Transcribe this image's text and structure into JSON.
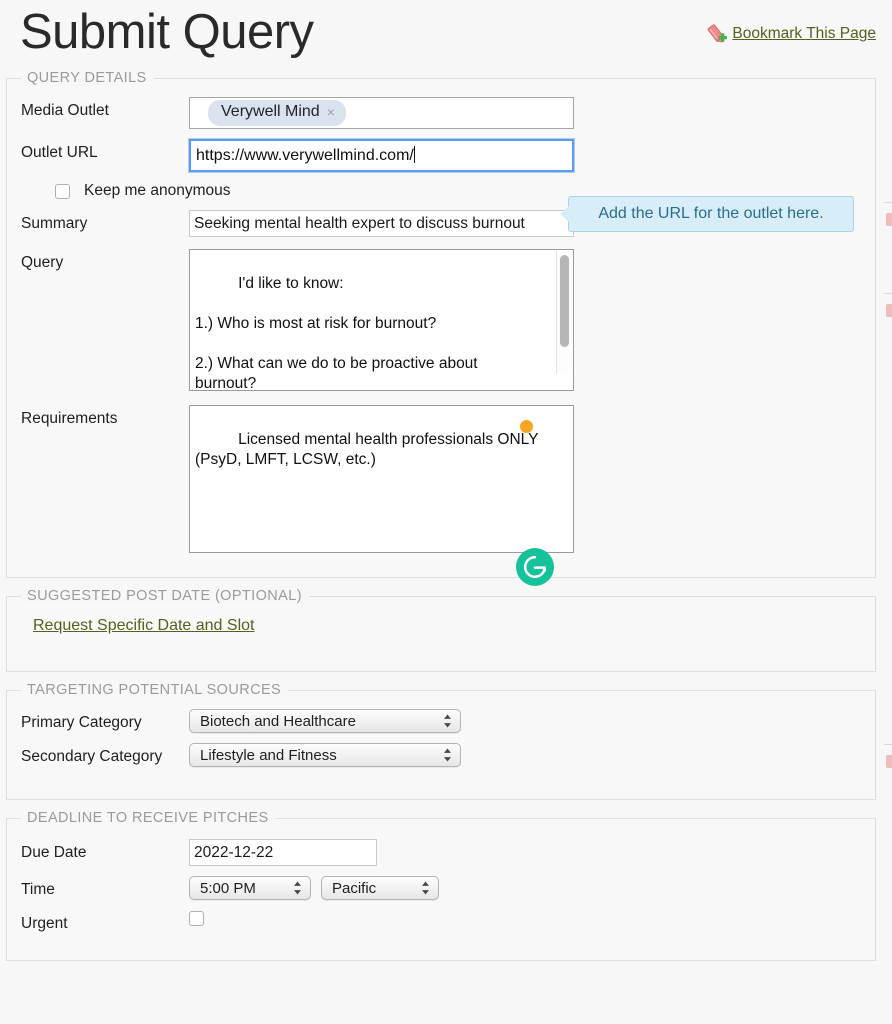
{
  "header": {
    "title": "Submit Query",
    "bookmark_label": "Bookmark This Page",
    "bookmark_icon": "bookmark-add-icon"
  },
  "sections": {
    "query_details": {
      "legend": "QUERY DETAILS",
      "media_outlet": {
        "label": "Media Outlet",
        "tag": "Verywell Mind",
        "remove_glyph": "×"
      },
      "outlet_url": {
        "label": "Outlet URL",
        "value": "https://www.verywellmind.com/",
        "focused": true
      },
      "anonymous": {
        "label": "Keep me anonymous",
        "checked": false
      },
      "summary": {
        "label": "Summary",
        "value": "Seeking mental health expert to discuss burnout"
      },
      "query": {
        "label": "Query",
        "value": "I'd like to know:\n\n1.) Who is most at risk for burnout?\n\n2.) What can we do to be proactive about\nburnout?"
      },
      "requirements": {
        "label": "Requirements",
        "value": "Licensed mental health professionals ONLY\n(PsyD, LMFT, LCSW, etc.)"
      }
    },
    "suggested_post_date": {
      "legend": "SUGGESTED POST DATE (OPTIONAL)",
      "link_label": "Request Specific Date and Slot"
    },
    "targeting": {
      "legend": "TARGETING POTENTIAL SOURCES",
      "primary": {
        "label": "Primary Category",
        "value": "Biotech and Healthcare"
      },
      "secondary": {
        "label": "Secondary Category",
        "value": "Lifestyle and Fitness"
      }
    },
    "deadline": {
      "legend": "DEADLINE TO RECEIVE PITCHES",
      "due_date": {
        "label": "Due Date",
        "value": "2022-12-22"
      },
      "time": {
        "label": "Time",
        "value": "5:00 PM",
        "zone": "Pacific"
      },
      "urgent": {
        "label": "Urgent",
        "checked": false
      }
    }
  },
  "tooltip": {
    "text": "Add the URL for the outlet here."
  },
  "overlays": {
    "grammarly_letter": "G",
    "grammarly_color": "#15c39a",
    "orange_dot_color": "#f5a623"
  },
  "colors": {
    "link": "#54611e",
    "focus_border": "#5b9bf8",
    "tooltip_bg": "#d7eef8",
    "tooltip_text": "#2b6d8c",
    "chip_bg": "#dbe2ef"
  }
}
